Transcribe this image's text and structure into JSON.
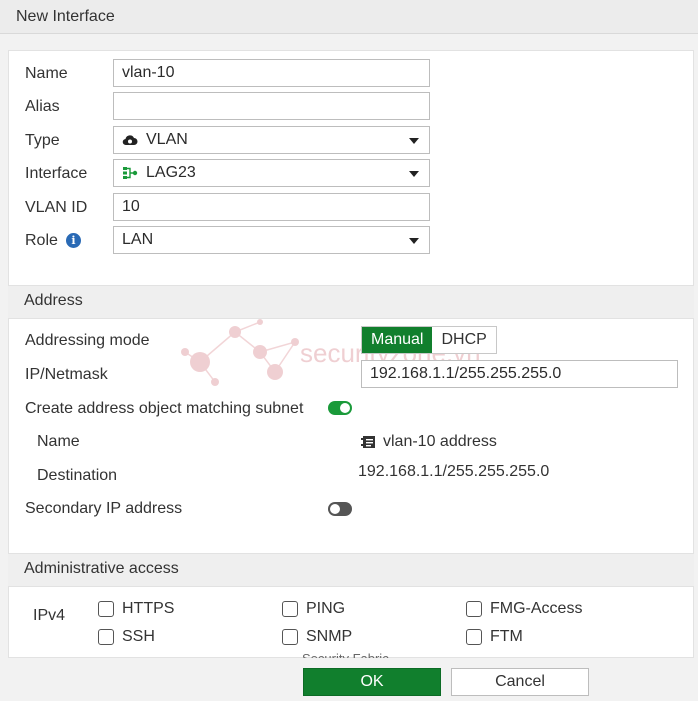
{
  "title": "New Interface",
  "form": {
    "name": {
      "label": "Name",
      "value": "vlan-10"
    },
    "alias": {
      "label": "Alias",
      "value": ""
    },
    "type": {
      "label": "Type",
      "value": "VLAN",
      "icon": "cloud-icon"
    },
    "interface": {
      "label": "Interface",
      "value": "LAG23",
      "icon": "network-aggregate-icon"
    },
    "vlan_id": {
      "label": "VLAN ID",
      "value": "10"
    },
    "role": {
      "label": "Role",
      "value": "LAN",
      "info_icon": "i"
    }
  },
  "address": {
    "header": "Address",
    "addressing_mode_label": "Addressing mode",
    "modes": [
      "Manual",
      "DHCP"
    ],
    "selected_mode": "Manual",
    "ip_label": "IP/Netmask",
    "ip_value": "192.168.1.1/255.255.255.0",
    "create_obj_label": "Create address object matching subnet",
    "create_obj_enabled": true,
    "obj_name_label": "Name",
    "obj_name_value": "vlan-10 address",
    "obj_dest_label": "Destination",
    "obj_dest_value": "192.168.1.1/255.255.255.0",
    "secondary_label": "Secondary IP address",
    "secondary_enabled": false
  },
  "admin": {
    "header": "Administrative access",
    "ipv4_label": "IPv4",
    "options": [
      "HTTPS",
      "PING",
      "FMG-Access",
      "SSH",
      "SNMP",
      "FTM"
    ],
    "partial_label": "Security Fabric"
  },
  "watermark": "securityzone.vn",
  "footer": {
    "ok": "OK",
    "cancel": "Cancel"
  },
  "colors": {
    "accent": "#117f2d",
    "info": "#2a6ab5"
  }
}
